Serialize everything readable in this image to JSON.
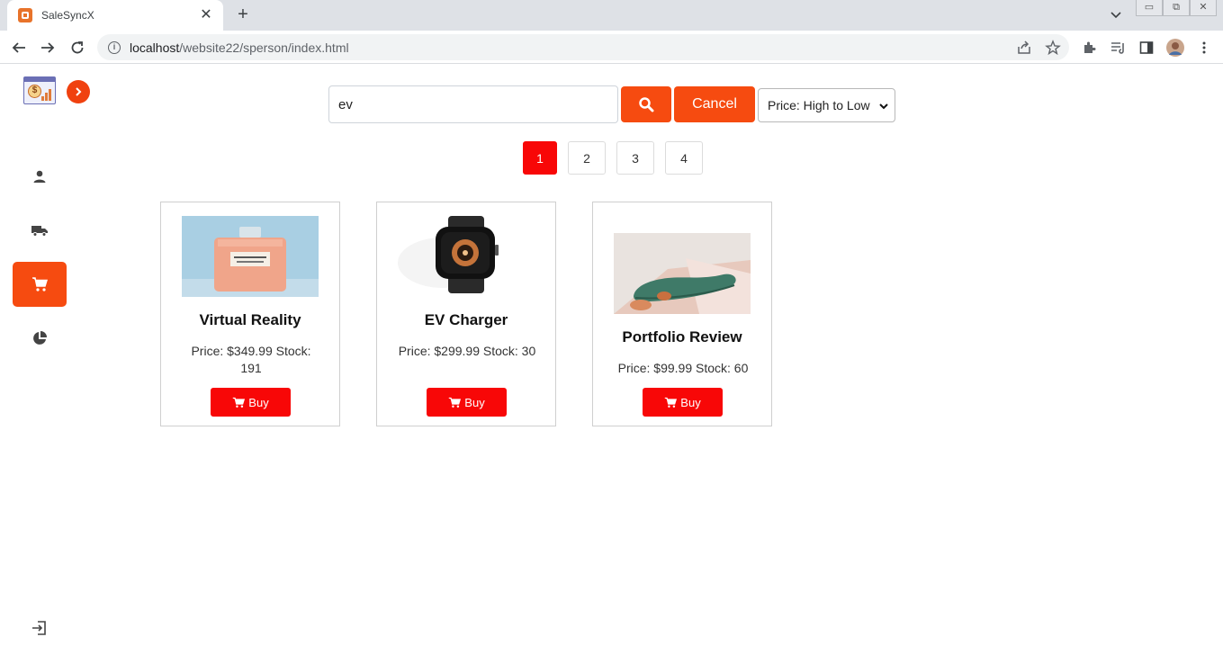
{
  "browser": {
    "tab_title": "SaleSyncX",
    "tab_close": "✕",
    "new_tab": "+",
    "url_host": "localhost",
    "url_path": "/website22/sperson/index.html",
    "window_min": "▭",
    "window_restore": "⧉",
    "window_close": "✕"
  },
  "search": {
    "value": "ev",
    "cancel_label": "Cancel"
  },
  "sort": {
    "selected": "Price: High to Low"
  },
  "pagination": {
    "pages": [
      "1",
      "2",
      "3",
      "4"
    ],
    "active": "1"
  },
  "products": [
    {
      "name": "Virtual Reality",
      "price_stock": "Price: $349.99 Stock: 191",
      "buy_label": "Buy"
    },
    {
      "name": "EV Charger",
      "price_stock": "Price: $299.99 Stock: 30",
      "buy_label": "Buy"
    },
    {
      "name": "Portfolio Review",
      "price_stock": "Price: $99.99 Stock: 60",
      "buy_label": "Buy"
    }
  ],
  "sidebar": {
    "items": [
      "user-icon",
      "truck-icon",
      "cart-icon",
      "pie-chart-icon"
    ],
    "active": "cart-icon",
    "logout": "logout-icon"
  },
  "colors": {
    "accent": "#f64b10",
    "buy": "#f80707"
  }
}
